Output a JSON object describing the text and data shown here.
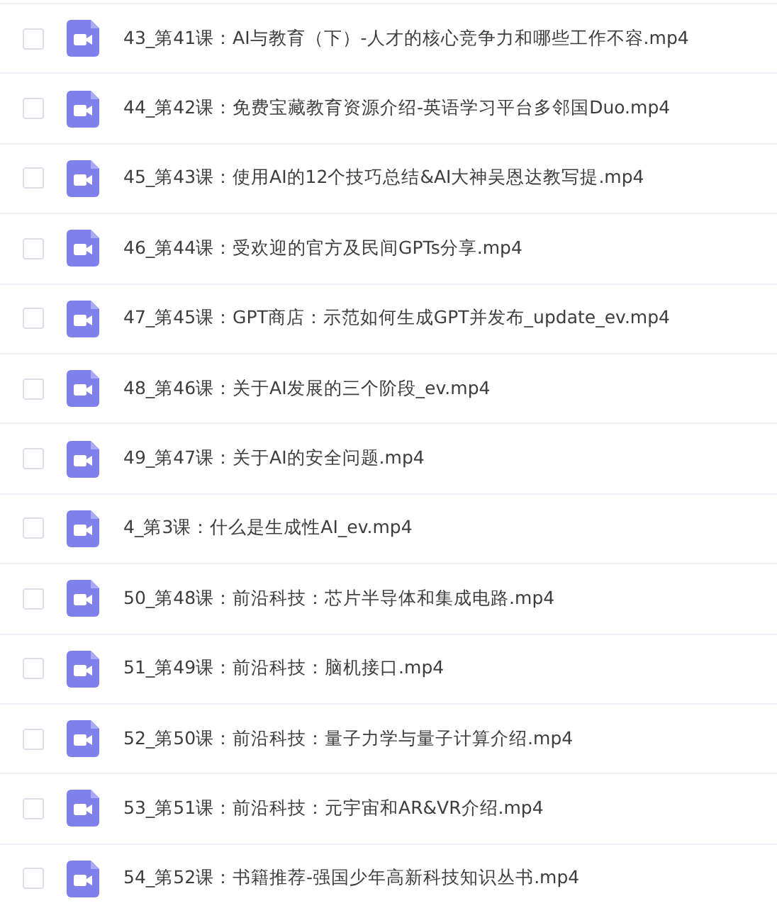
{
  "files": [
    {
      "name": "43_第41课：AI与教育（下）-人才的核心竞争力和哪些工作不容.mp4",
      "checked": false
    },
    {
      "name": "44_第42课：免费宝藏教育资源介绍-英语学习平台多邻国Duo.mp4",
      "checked": false
    },
    {
      "name": "45_第43课：使用AI的12个技巧总结&AI大神吴恩达教写提.mp4",
      "checked": false
    },
    {
      "name": "46_第44课：受欢迎的官方及民间GPTs分享.mp4",
      "checked": false
    },
    {
      "name": "47_第45课：GPT商店：示范如何生成GPT并发布_update_ev.mp4",
      "checked": false
    },
    {
      "name": "48_第46课：关于AI发展的三个阶段_ev.mp4",
      "checked": false
    },
    {
      "name": "49_第47课：关于AI的安全问题.mp4",
      "checked": false
    },
    {
      "name": "4_第3课：什么是生成性AI_ev.mp4",
      "checked": false
    },
    {
      "name": "50_第48课：前沿科技：芯片半导体和集成电路.mp4",
      "checked": false
    },
    {
      "name": "51_第49课：前沿科技：脑机接口.mp4",
      "checked": false
    },
    {
      "name": "52_第50课：前沿科技：量子力学与量子计算介绍.mp4",
      "checked": false
    },
    {
      "name": "53_第51课：前沿科技：元宇宙和AR&VR介绍.mp4",
      "checked": false
    },
    {
      "name": "54_第52课：书籍推荐-强国少年高新科技知识丛书.mp4",
      "checked": false
    }
  ]
}
